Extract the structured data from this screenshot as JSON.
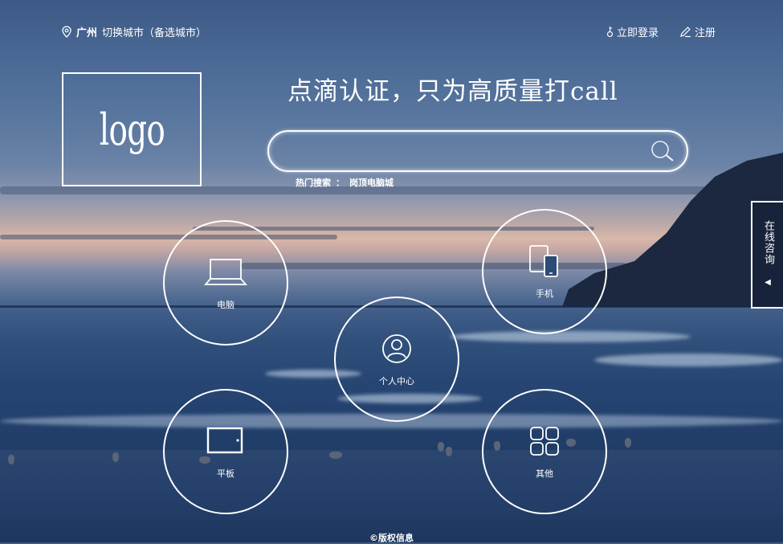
{
  "header": {
    "location_icon": "map-pin-icon",
    "city": "广州",
    "switch_city": "切换城市（备选城市）",
    "login": "立即登录",
    "login_icon": "key-icon",
    "register": "注册",
    "register_icon": "pencil-icon"
  },
  "logo": {
    "text": "logo"
  },
  "slogan": "点滴认证，只为高质量打call",
  "search": {
    "value": "",
    "placeholder": "",
    "button_icon": "search-icon"
  },
  "hot_search": {
    "label": "热门搜索",
    "separator": "：",
    "items": [
      "岗顶电脑城"
    ]
  },
  "categories": [
    {
      "label": "电脑",
      "icon": "laptop-icon"
    },
    {
      "label": "手机",
      "icon": "phone-icon"
    },
    {
      "label": "个人中心",
      "icon": "user-icon"
    },
    {
      "label": "平板",
      "icon": "tablet-icon"
    },
    {
      "label": "其他",
      "icon": "grid-icon"
    }
  ],
  "consult": {
    "label": "在线咨询",
    "icon": "caret-left-icon"
  },
  "footer": {
    "copyright": "©版权信息"
  }
}
